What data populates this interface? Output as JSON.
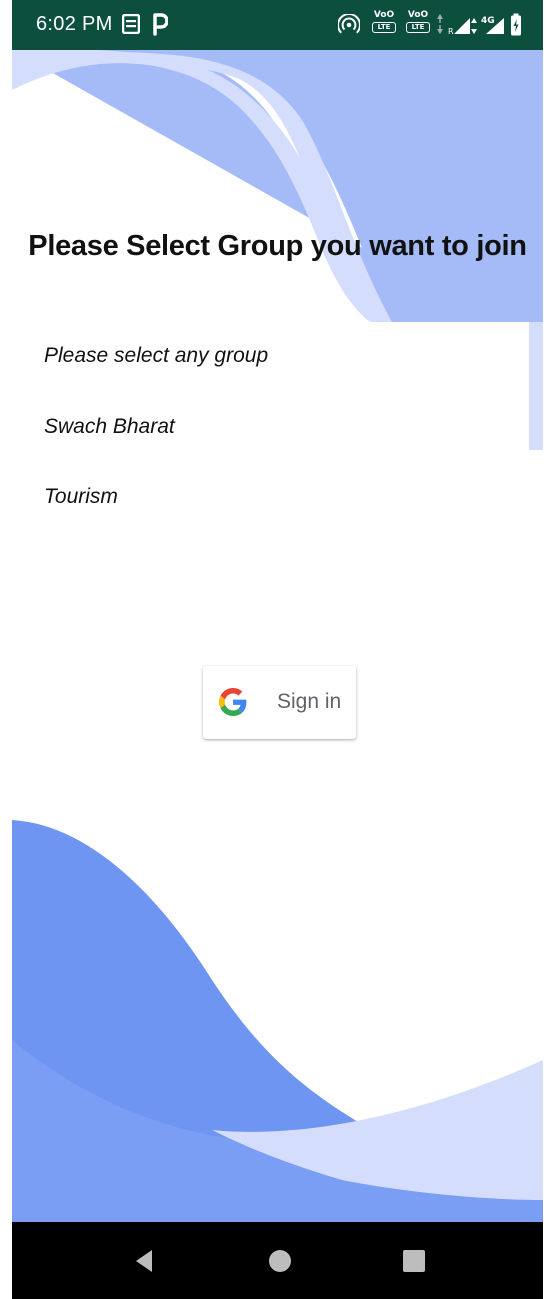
{
  "status_bar": {
    "time": "6:02 PM",
    "icons": [
      "notes-icon",
      "parking-app-icon",
      "hotspot-icon",
      "volte-icon",
      "volte-icon",
      "data-arrows-icon",
      "signal-icon",
      "battery-charging-icon"
    ],
    "volte_top": "VoO",
    "volte_bottom": "LTE",
    "network": "4G"
  },
  "main": {
    "title": "Please Select Group you want to join",
    "group_options": [
      "Please select any group",
      "Swach Bharat",
      "Tourism"
    ]
  },
  "signin": {
    "label": "Sign in",
    "icon": "google-g-icon"
  },
  "nav_bar": {
    "buttons": [
      "back-icon",
      "home-icon",
      "recents-icon"
    ]
  },
  "colors": {
    "status_bar": "#0b4f3c",
    "wave_light": "#d4defc",
    "wave_mid": "#a4bbf8",
    "wave_dark": "#6f95f2",
    "nav_bar": "#000000"
  }
}
